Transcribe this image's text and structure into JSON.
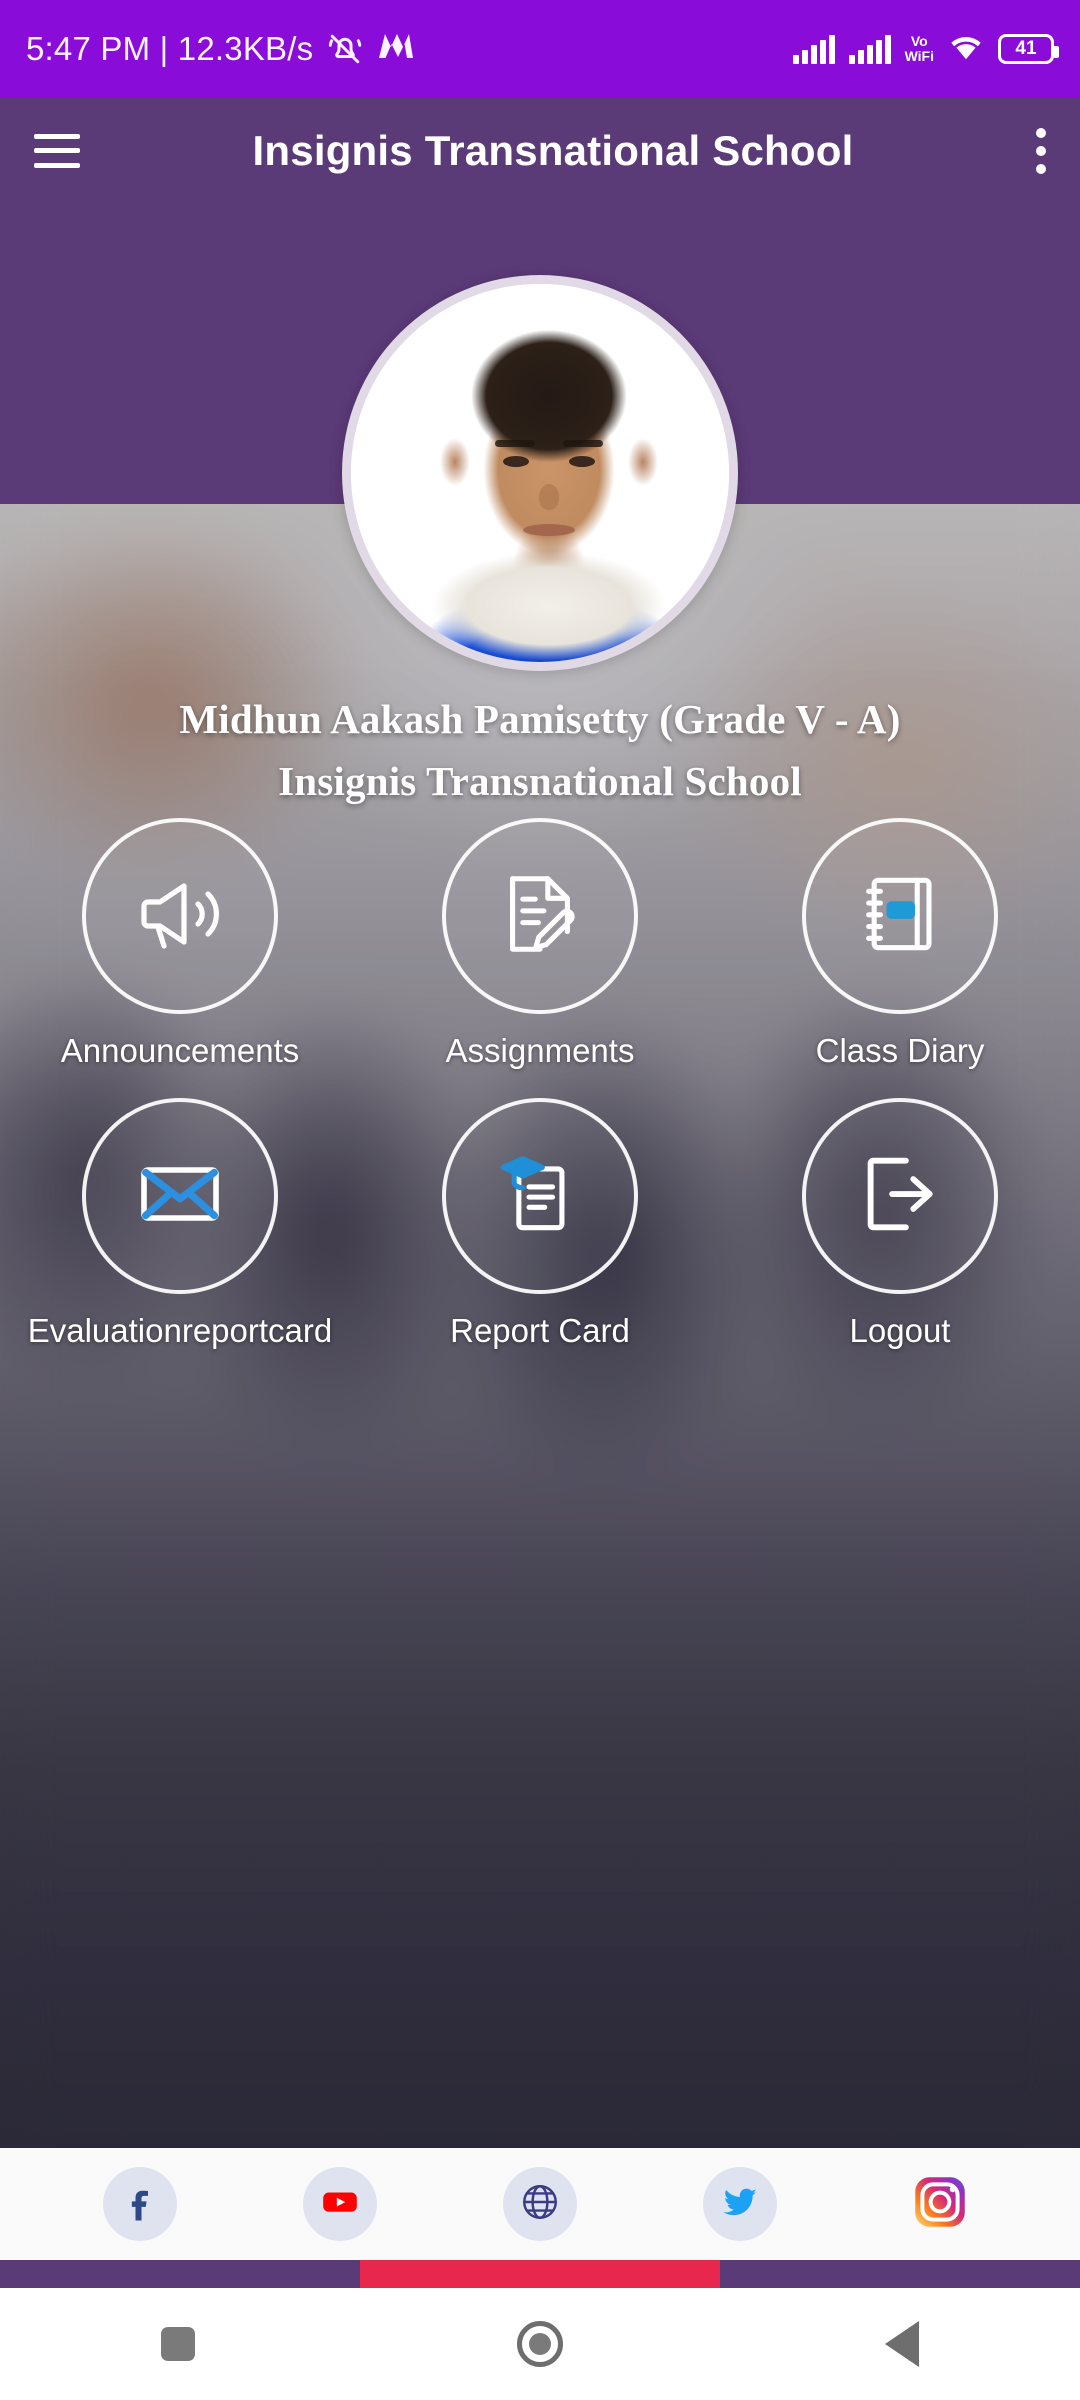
{
  "status_bar": {
    "time_and_data": "5:47 PM | 12.3KB/s",
    "mute_icon": "bell-mute-icon",
    "brand_icon": "m-logo-icon",
    "signal_1": "signal-bars-icon",
    "signal_2": "signal-bars-icon",
    "vowifi_line1": "Vo",
    "vowifi_line2": "WiFi",
    "wifi_icon": "wifi-icon",
    "battery_level": "41",
    "background_color": "#8A0CD9"
  },
  "app_bar": {
    "menu_icon": "hamburger-menu-icon",
    "title": "Insignis Transnational School",
    "overflow_icon": "kebab-menu-icon",
    "background_color": "#5B3A78"
  },
  "profile": {
    "avatar_alt": "student-portrait",
    "name_line_1": "Midhun Aakash Pamisetty (Grade V - A)",
    "name_line_2": "Insignis Transnational School"
  },
  "menu_grid": {
    "items": [
      {
        "label": "Announcements",
        "icon": "megaphone-icon"
      },
      {
        "label": "Assignments",
        "icon": "document-pencil-icon"
      },
      {
        "label": "Class Diary",
        "icon": "spiral-notebook-icon"
      },
      {
        "label": "Evaluationreportcard",
        "icon": "envelope-icon"
      },
      {
        "label": "Report Card",
        "icon": "graduation-clipboard-icon"
      },
      {
        "label": "Logout",
        "icon": "logout-arrow-icon"
      }
    ]
  },
  "social_bar": {
    "items": [
      {
        "name": "facebook",
        "icon": "facebook-icon",
        "color": "#2d4a86"
      },
      {
        "name": "youtube",
        "icon": "youtube-icon",
        "color": "#FF0000"
      },
      {
        "name": "website",
        "icon": "globe-icon",
        "color": "#3b3b86"
      },
      {
        "name": "twitter",
        "icon": "twitter-icon",
        "color": "#1DA1F2"
      },
      {
        "name": "instagram",
        "icon": "instagram-icon",
        "color": "#C13584"
      }
    ]
  },
  "bottom_strips": {
    "left_color": "#5B3A78",
    "center_color": "#E8274F",
    "right_color": "#5B3A78"
  },
  "nav_bar": {
    "recents_icon": "square-recents-icon",
    "home_icon": "circle-home-icon",
    "back_icon": "triangle-back-icon"
  }
}
